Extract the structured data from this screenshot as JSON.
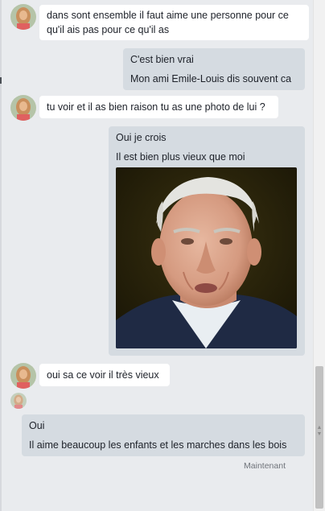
{
  "contact": {
    "avatar_icon": "contact-avatar-photo"
  },
  "messages": [
    {
      "id": 1,
      "direction": "incoming",
      "lines": [
        "dans sont ensemble il faut aime une personne pour ce",
        "qu'il ais pas pour ce qu'il as"
      ]
    },
    {
      "id": 2,
      "direction": "outgoing",
      "lines": [
        "C'est bien vrai",
        "Mon ami Emile-Louis dis souvent ca"
      ]
    },
    {
      "id": 3,
      "direction": "incoming",
      "lines": [
        "tu voir et il as bien raison tu as une photo de lui ?"
      ]
    },
    {
      "id": 4,
      "direction": "outgoing",
      "lines": [
        "Oui je crois",
        "Il est bien plus vieux que moi"
      ],
      "attachment": "photo-of-elderly-man"
    },
    {
      "id": 5,
      "direction": "incoming",
      "lines": [
        "oui sa ce voir il très vieux"
      ]
    },
    {
      "id": 6,
      "direction": "outgoing",
      "lines": [
        "Oui",
        "Il aime beaucoup les enfants et les marches dans les bois"
      ]
    }
  ],
  "status": {
    "timestamp": "Maintenant"
  },
  "colors": {
    "background": "#e9ebee",
    "incoming_bubble": "#ffffff",
    "outgoing_bubble": "#d5dbe1",
    "text": "#1d2129"
  }
}
